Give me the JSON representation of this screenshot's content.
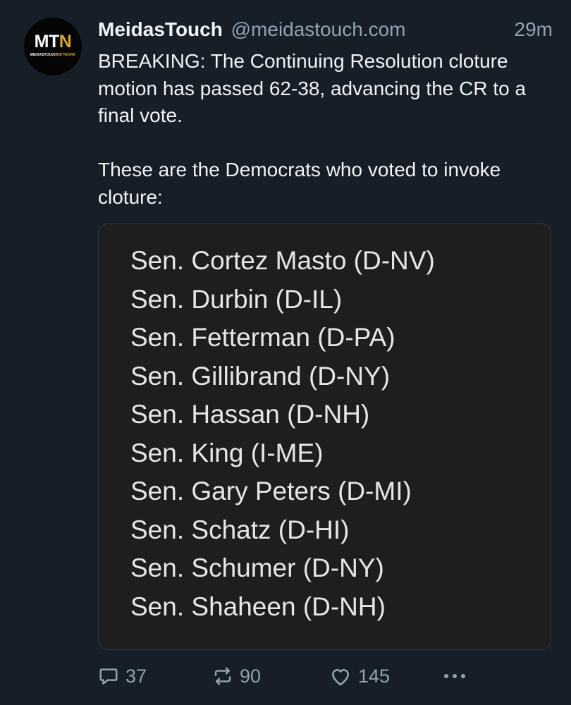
{
  "post": {
    "avatar": {
      "logo_main": "MT",
      "logo_accent": "N",
      "logo_sub_main": "MEIDASTOUCH",
      "logo_sub_accent": "NETWORK"
    },
    "display_name": "MeidasTouch",
    "handle": "@meidastouch.com",
    "timestamp": "29m",
    "paragraphs": [
      "BREAKING: The Continuing Resolution cloture motion has passed 62-38, advancing the CR to a final vote.",
      "These are the Democrats who voted to invoke cloture:"
    ],
    "embed_list": [
      "Sen. Cortez Masto (D-NV)",
      "Sen. Durbin (D-IL)",
      "Sen. Fetterman (D-PA)",
      "Sen. Gillibrand (D-NY)",
      "Sen. Hassan (D-NH)",
      "Sen. King (I-ME)",
      "Sen. Gary Peters (D-MI)",
      "Sen. Schatz (D-HI)",
      "Sen. Schumer (D-NY)",
      "Sen. Shaheen (D-NH)"
    ],
    "actions": {
      "reply_count": "37",
      "repost_count": "90",
      "like_count": "145",
      "reply_icon": "reply-icon",
      "repost_icon": "repost-icon",
      "like_icon": "heart-icon",
      "more_icon": "more-icon"
    }
  },
  "colors": {
    "background": "#161e27",
    "text_primary": "#f1f3f5",
    "text_secondary": "#93a1b0",
    "embed_background": "#1e1e1e",
    "logo_accent": "#d4a72c"
  }
}
